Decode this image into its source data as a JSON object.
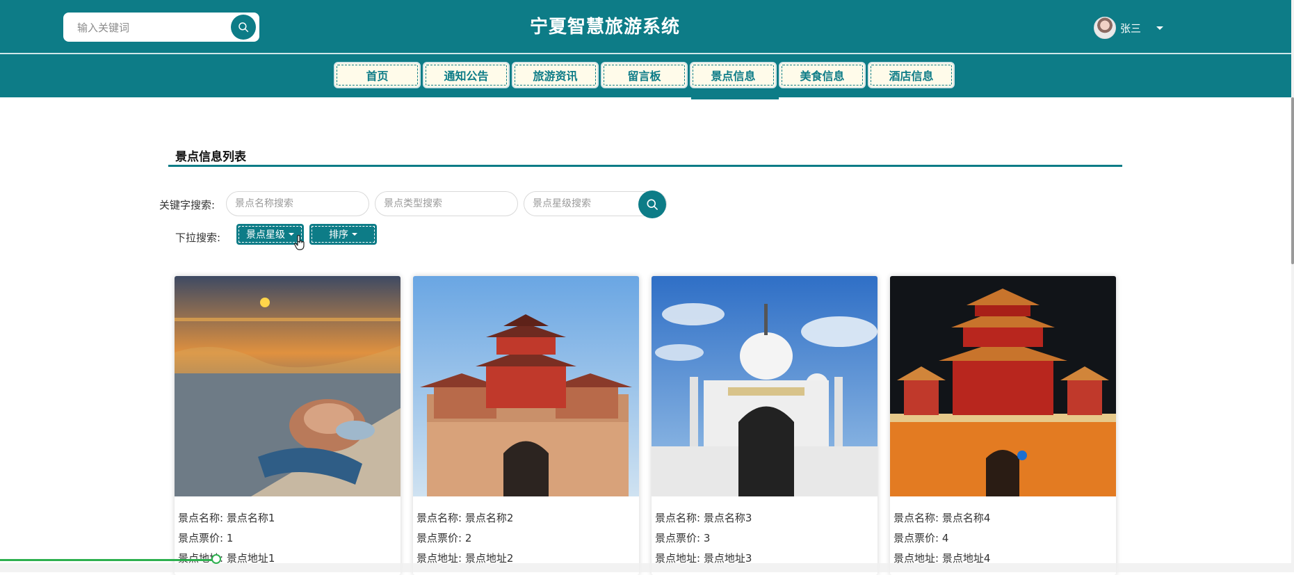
{
  "header": {
    "search_placeholder": "输入关键词",
    "title": "宁夏智慧旅游系统",
    "username": "张三"
  },
  "nav": {
    "items": [
      {
        "label": "首页"
      },
      {
        "label": "通知公告"
      },
      {
        "label": "旅游资讯"
      },
      {
        "label": "留言板"
      },
      {
        "label": "景点信息",
        "active": true
      },
      {
        "label": "美食信息"
      },
      {
        "label": "酒店信息"
      }
    ]
  },
  "section": {
    "title": "景点信息列表"
  },
  "filters": {
    "keyword_label": "关键字搜索:",
    "name_placeholder": "景点名称搜索",
    "type_placeholder": "景点类型搜索",
    "level_placeholder": "景点星级搜索",
    "dropdown_label": "下拉搜索:",
    "level_dropdown": "景点星级",
    "sort_dropdown": "排序"
  },
  "cards": [
    {
      "name_label": "景点名称:",
      "name": "景点名称1",
      "price_label": "景点票价:",
      "price": "1",
      "address_label": "景点地址:",
      "address": "景点地址1"
    },
    {
      "name_label": "景点名称:",
      "name": "景点名称2",
      "price_label": "景点票价:",
      "price": "2",
      "address_label": "景点地址:",
      "address": "景点地址2"
    },
    {
      "name_label": "景点名称:",
      "name": "景点名称3",
      "price_label": "景点票价:",
      "price": "3",
      "address_label": "景点地址:",
      "address": "景点地址3"
    },
    {
      "name_label": "景点名称:",
      "name": "景点名称4",
      "price_label": "景点票价:",
      "price": "4",
      "address_label": "景点地址:",
      "address": "景点地址4"
    }
  ],
  "colors": {
    "primary": "#0d7c87",
    "nav_bg": "#fffbea",
    "progress": "#2db04f"
  },
  "icons": [
    "search-icon",
    "chevron-down-icon",
    "pointer-cursor-icon"
  ]
}
